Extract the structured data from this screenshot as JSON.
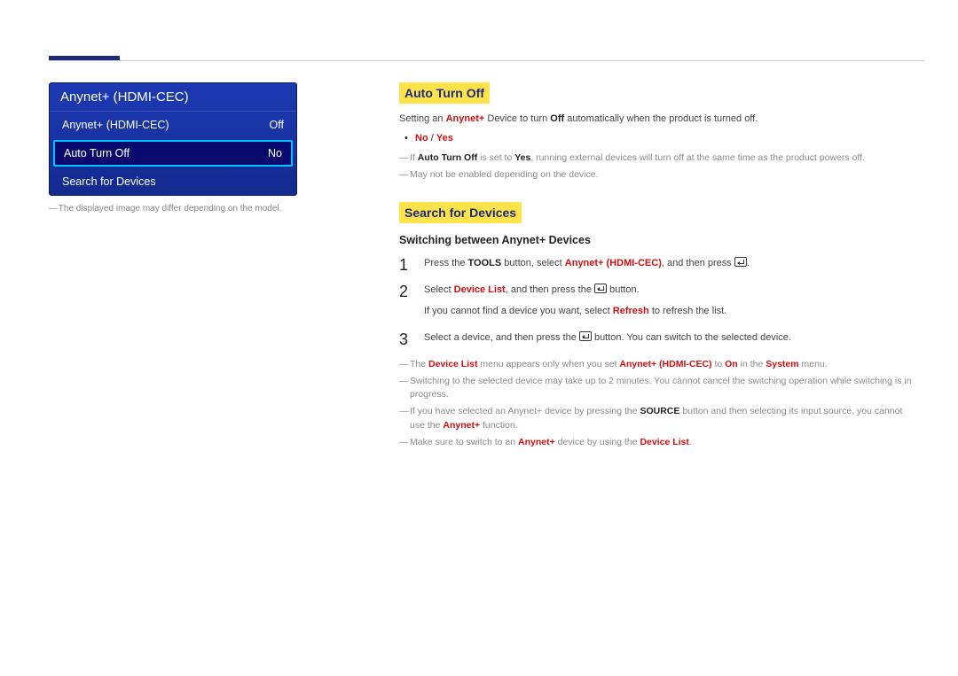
{
  "osd": {
    "title": "Anynet+ (HDMI-CEC)",
    "rows": [
      {
        "label": "Anynet+ (HDMI-CEC)",
        "value": "Off",
        "selected": false
      },
      {
        "label": "Auto Turn Off",
        "value": "No",
        "selected": true
      },
      {
        "label": "Search for Devices",
        "value": "",
        "selected": false
      }
    ],
    "caption": "The displayed image may differ depending on the model."
  },
  "section_autoturnoff": {
    "heading": "Auto Turn Off",
    "intro": {
      "pre": "Setting an ",
      "kw1": "Anynet+",
      "mid": " Device to turn ",
      "kw2": "Off",
      "post": " automatically when the product is turned off."
    },
    "options": {
      "no": "No",
      "sep": " / ",
      "yes": "Yes"
    },
    "note1": {
      "pre": "If ",
      "kw1": "Auto Turn Off",
      "mid": " is set to ",
      "kw2": "Yes",
      "post": ", running external devices will turn off at the same time as the product powers off."
    },
    "note2": "May not be enabled depending on the device."
  },
  "section_search": {
    "heading": "Search for Devices",
    "subheading": "Switching between Anynet+ Devices",
    "step1": {
      "pre": "Press the ",
      "kw1": "TOOLS",
      "mid": " button, select ",
      "kw2": "Anynet+ (HDMI-CEC)",
      "post1": ", and then press ",
      "post2": "."
    },
    "step2": {
      "line1": {
        "pre": "Select ",
        "kw1": "Device List",
        "mid": ", and then press the ",
        "post": " button."
      },
      "line2": {
        "pre": "If you cannot find a device you want, select ",
        "kw1": "Refresh",
        "post": " to refresh the list."
      }
    },
    "step3": {
      "pre": "Select a device, and then press the ",
      "post": " button. You can switch to the selected device."
    },
    "footnote1": {
      "pre": "The ",
      "kw1": "Device List",
      "mid1": " menu appears only when you set ",
      "kw2": "Anynet+ (HDMI-CEC)",
      "mid2": " to ",
      "kw3": "On",
      "mid3": " in the ",
      "kw4": "System",
      "post": " menu."
    },
    "footnote2": "Switching to the selected device may take up to 2 minutes. You cannot cancel the switching operation while switching is in progress.",
    "footnote3": {
      "pre": "If you have selected an Anynet+ device by pressing the ",
      "kw1": "SOURCE",
      "mid": " button and then selecting its input source, you cannot use the ",
      "kw2": "Anynet+",
      "post": " function."
    },
    "footnote4": {
      "pre": "Make sure to switch to an ",
      "kw1": "Anynet+",
      "mid": " device by using the ",
      "kw2": "Device List",
      "post": "."
    }
  }
}
